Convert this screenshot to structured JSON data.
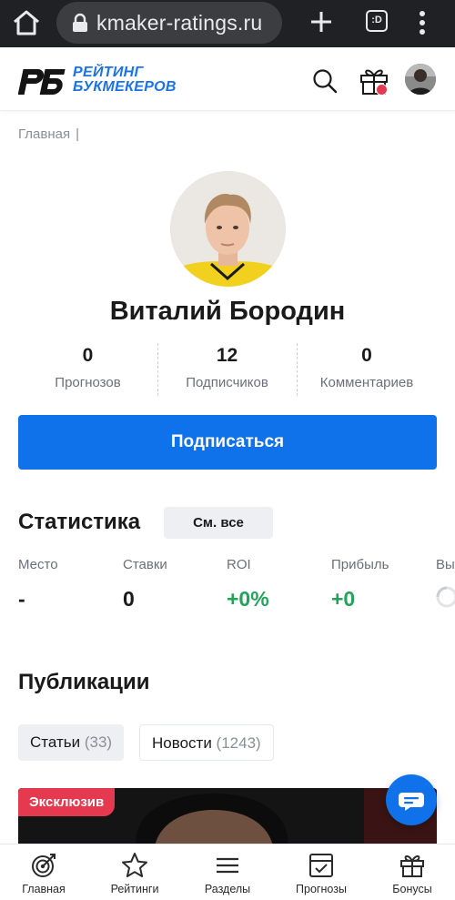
{
  "browser": {
    "url": "kmaker-ratings.ru",
    "tab_count_label": ":D"
  },
  "header": {
    "logo_mark": "РБ",
    "logo_line1": "РЕЙТИНГ",
    "logo_line2": "БУКМЕКЕРОВ",
    "brand_color": "#1a73e8"
  },
  "breadcrumb": {
    "home": "Главная",
    "separator": "|"
  },
  "profile": {
    "name": "Виталий Бородин",
    "stats": [
      {
        "value": "0",
        "label": "Прогнозов"
      },
      {
        "value": "12",
        "label": "Подписчиков"
      },
      {
        "value": "0",
        "label": "Комментариев"
      }
    ],
    "subscribe_label": "Подписаться"
  },
  "statistics": {
    "title": "Статистика",
    "see_all_label": "См. все",
    "metrics": [
      {
        "label": "Место",
        "value": "-"
      },
      {
        "label": "Ставки",
        "value": "0"
      },
      {
        "label": "ROI",
        "value": "+0%"
      },
      {
        "label": "Прибыль",
        "value": "+0"
      },
      {
        "label": "Вы"
      }
    ]
  },
  "publications": {
    "title": "Публикации",
    "tabs": [
      {
        "label": "Статьи",
        "count": "(33)",
        "active": true
      },
      {
        "label": "Новости",
        "count": "(1243)",
        "active": false
      }
    ],
    "card_badge": "Эксклюзив"
  },
  "bottom_nav": [
    {
      "label": "Главная",
      "icon": "target-icon"
    },
    {
      "label": "Рейтинги",
      "icon": "star-icon"
    },
    {
      "label": "Разделы",
      "icon": "menu-icon"
    },
    {
      "label": "Прогнозы",
      "icon": "forecast-icon"
    },
    {
      "label": "Бонусы",
      "icon": "gift-icon"
    }
  ],
  "colors": {
    "accent": "#0f72ea",
    "positive": "#22a45a",
    "badge": "#e53950"
  }
}
